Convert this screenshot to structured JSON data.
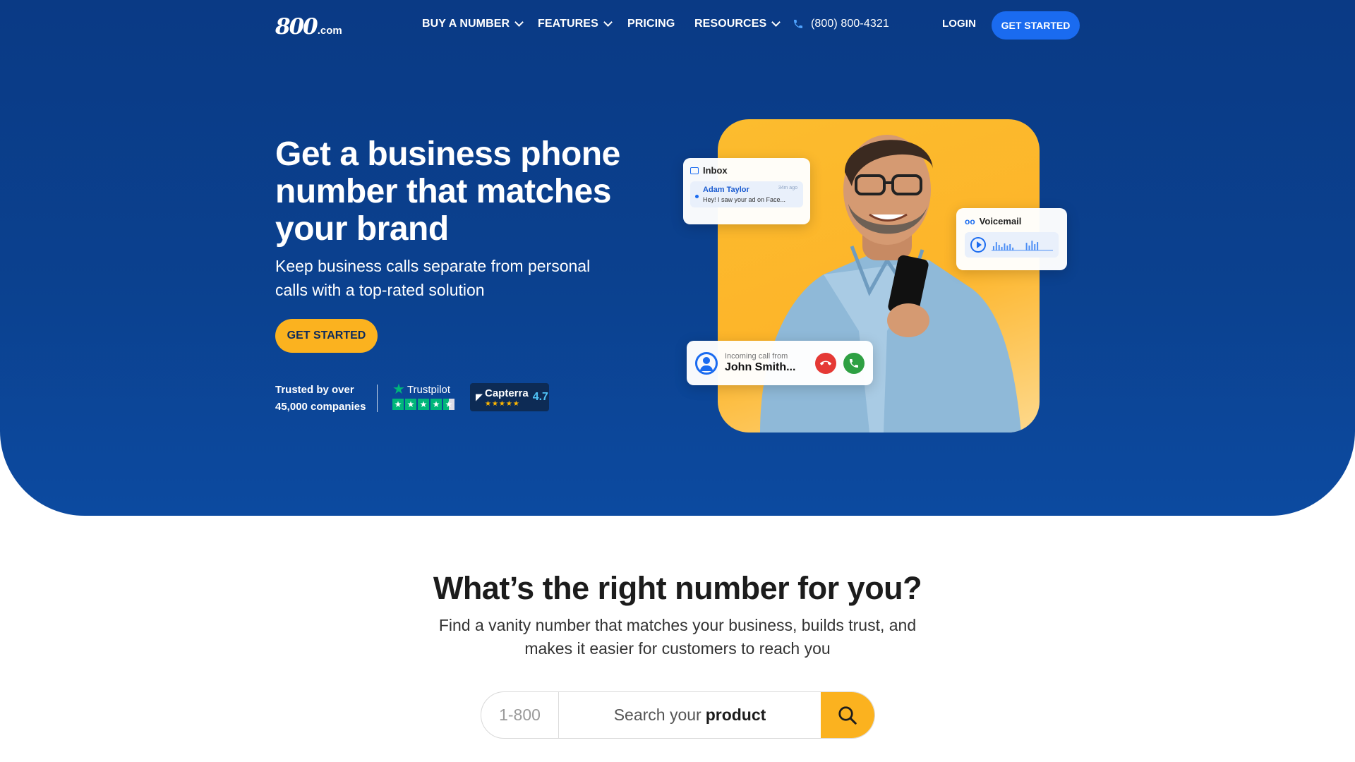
{
  "nav": {
    "logo_main": "800",
    "logo_suffix": ".com",
    "items": [
      {
        "label": "BUY A NUMBER",
        "dropdown": true
      },
      {
        "label": "FEATURES",
        "dropdown": true
      },
      {
        "label": "PRICING",
        "dropdown": false
      },
      {
        "label": "RESOURCES",
        "dropdown": true
      }
    ],
    "phone": "(800) 800-4321",
    "login": "LOGIN",
    "cta": "GET STARTED"
  },
  "hero": {
    "headline": "Get a business phone number that matches your brand",
    "subhead": "Keep business calls separate from personal calls with a top-rated solution",
    "cta": "GET STARTED",
    "trust_line1": "Trusted by over",
    "trust_line2": "45,000 companies",
    "trustpilot_label": "Trustpilot",
    "trustpilot_stars": 4.5,
    "capterra_label": "Capterra",
    "capterra_score": "4.7"
  },
  "cards": {
    "inbox": {
      "title": "Inbox",
      "sender": "Adam Taylor",
      "time": "34m ago",
      "message": "Hey! I saw your ad on Face..."
    },
    "voicemail": {
      "title": "Voicemail"
    },
    "incoming": {
      "label": "Incoming call from",
      "name": "John Smith..."
    }
  },
  "finder": {
    "title": "What’s the right number for you?",
    "subtitle": "Find a vanity number that matches your business, builds trust, and makes it easier for customers to reach you",
    "prefix": "1-800",
    "search_lead": "Search your",
    "search_word": "product"
  },
  "colors": {
    "hero_bg": "#0b418f",
    "accent_blue": "#1a6bf0",
    "accent_yellow": "#fbb21f"
  }
}
